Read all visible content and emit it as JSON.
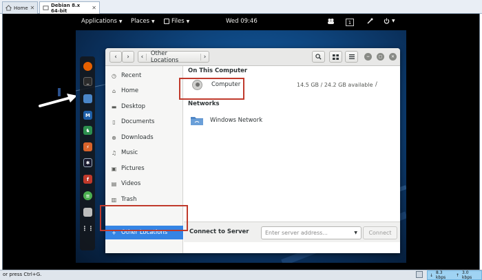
{
  "vm": {
    "tabs": [
      {
        "label": "Home",
        "active": false
      },
      {
        "label": "Debian 8.x 64-bit",
        "active": true
      }
    ],
    "status_hint": "or press Ctrl+G.",
    "net_down": "8.3 kbps",
    "net_up": "3.0 kbps"
  },
  "topbar": {
    "applications": "Applications",
    "places": "Places",
    "files": "Files",
    "clock": "Wed 09:46",
    "workspace": "1"
  },
  "dock": {
    "icons": [
      "firefox-icon",
      "terminal-icon",
      "files-icon",
      "metasploit-icon",
      "armitage-icon",
      "burpsuite-icon",
      "maltego-icon",
      "faraday-icon",
      "leafpad-icon",
      "gnome-screenshot-icon",
      "app-grid-icon"
    ]
  },
  "file_manager": {
    "location": "Other Locations",
    "sidebar": [
      {
        "label": "Recent",
        "icon": "clock-icon"
      },
      {
        "label": "Home",
        "icon": "home-icon"
      },
      {
        "label": "Desktop",
        "icon": "desktop-icon"
      },
      {
        "label": "Documents",
        "icon": "document-icon"
      },
      {
        "label": "Downloads",
        "icon": "download-icon"
      },
      {
        "label": "Music",
        "icon": "music-icon"
      },
      {
        "label": "Pictures",
        "icon": "pictures-icon"
      },
      {
        "label": "Videos",
        "icon": "video-icon"
      },
      {
        "label": "Trash",
        "icon": "trash-icon"
      },
      {
        "label": "Other Locations",
        "icon": "plus-icon",
        "selected": true
      }
    ],
    "on_this_computer_title": "On This Computer",
    "computer": {
      "name": "Computer",
      "space": "14.5 GB / 24.2 GB available",
      "mount": "/"
    },
    "networks_title": "Networks",
    "network": {
      "name": "Windows Network"
    },
    "connect_to_server": "Connect to Server",
    "server_placeholder": "Enter server address...",
    "connect_button": "Connect"
  },
  "colors": {
    "selection": "#3584e4",
    "annotation": "#c0392b"
  }
}
